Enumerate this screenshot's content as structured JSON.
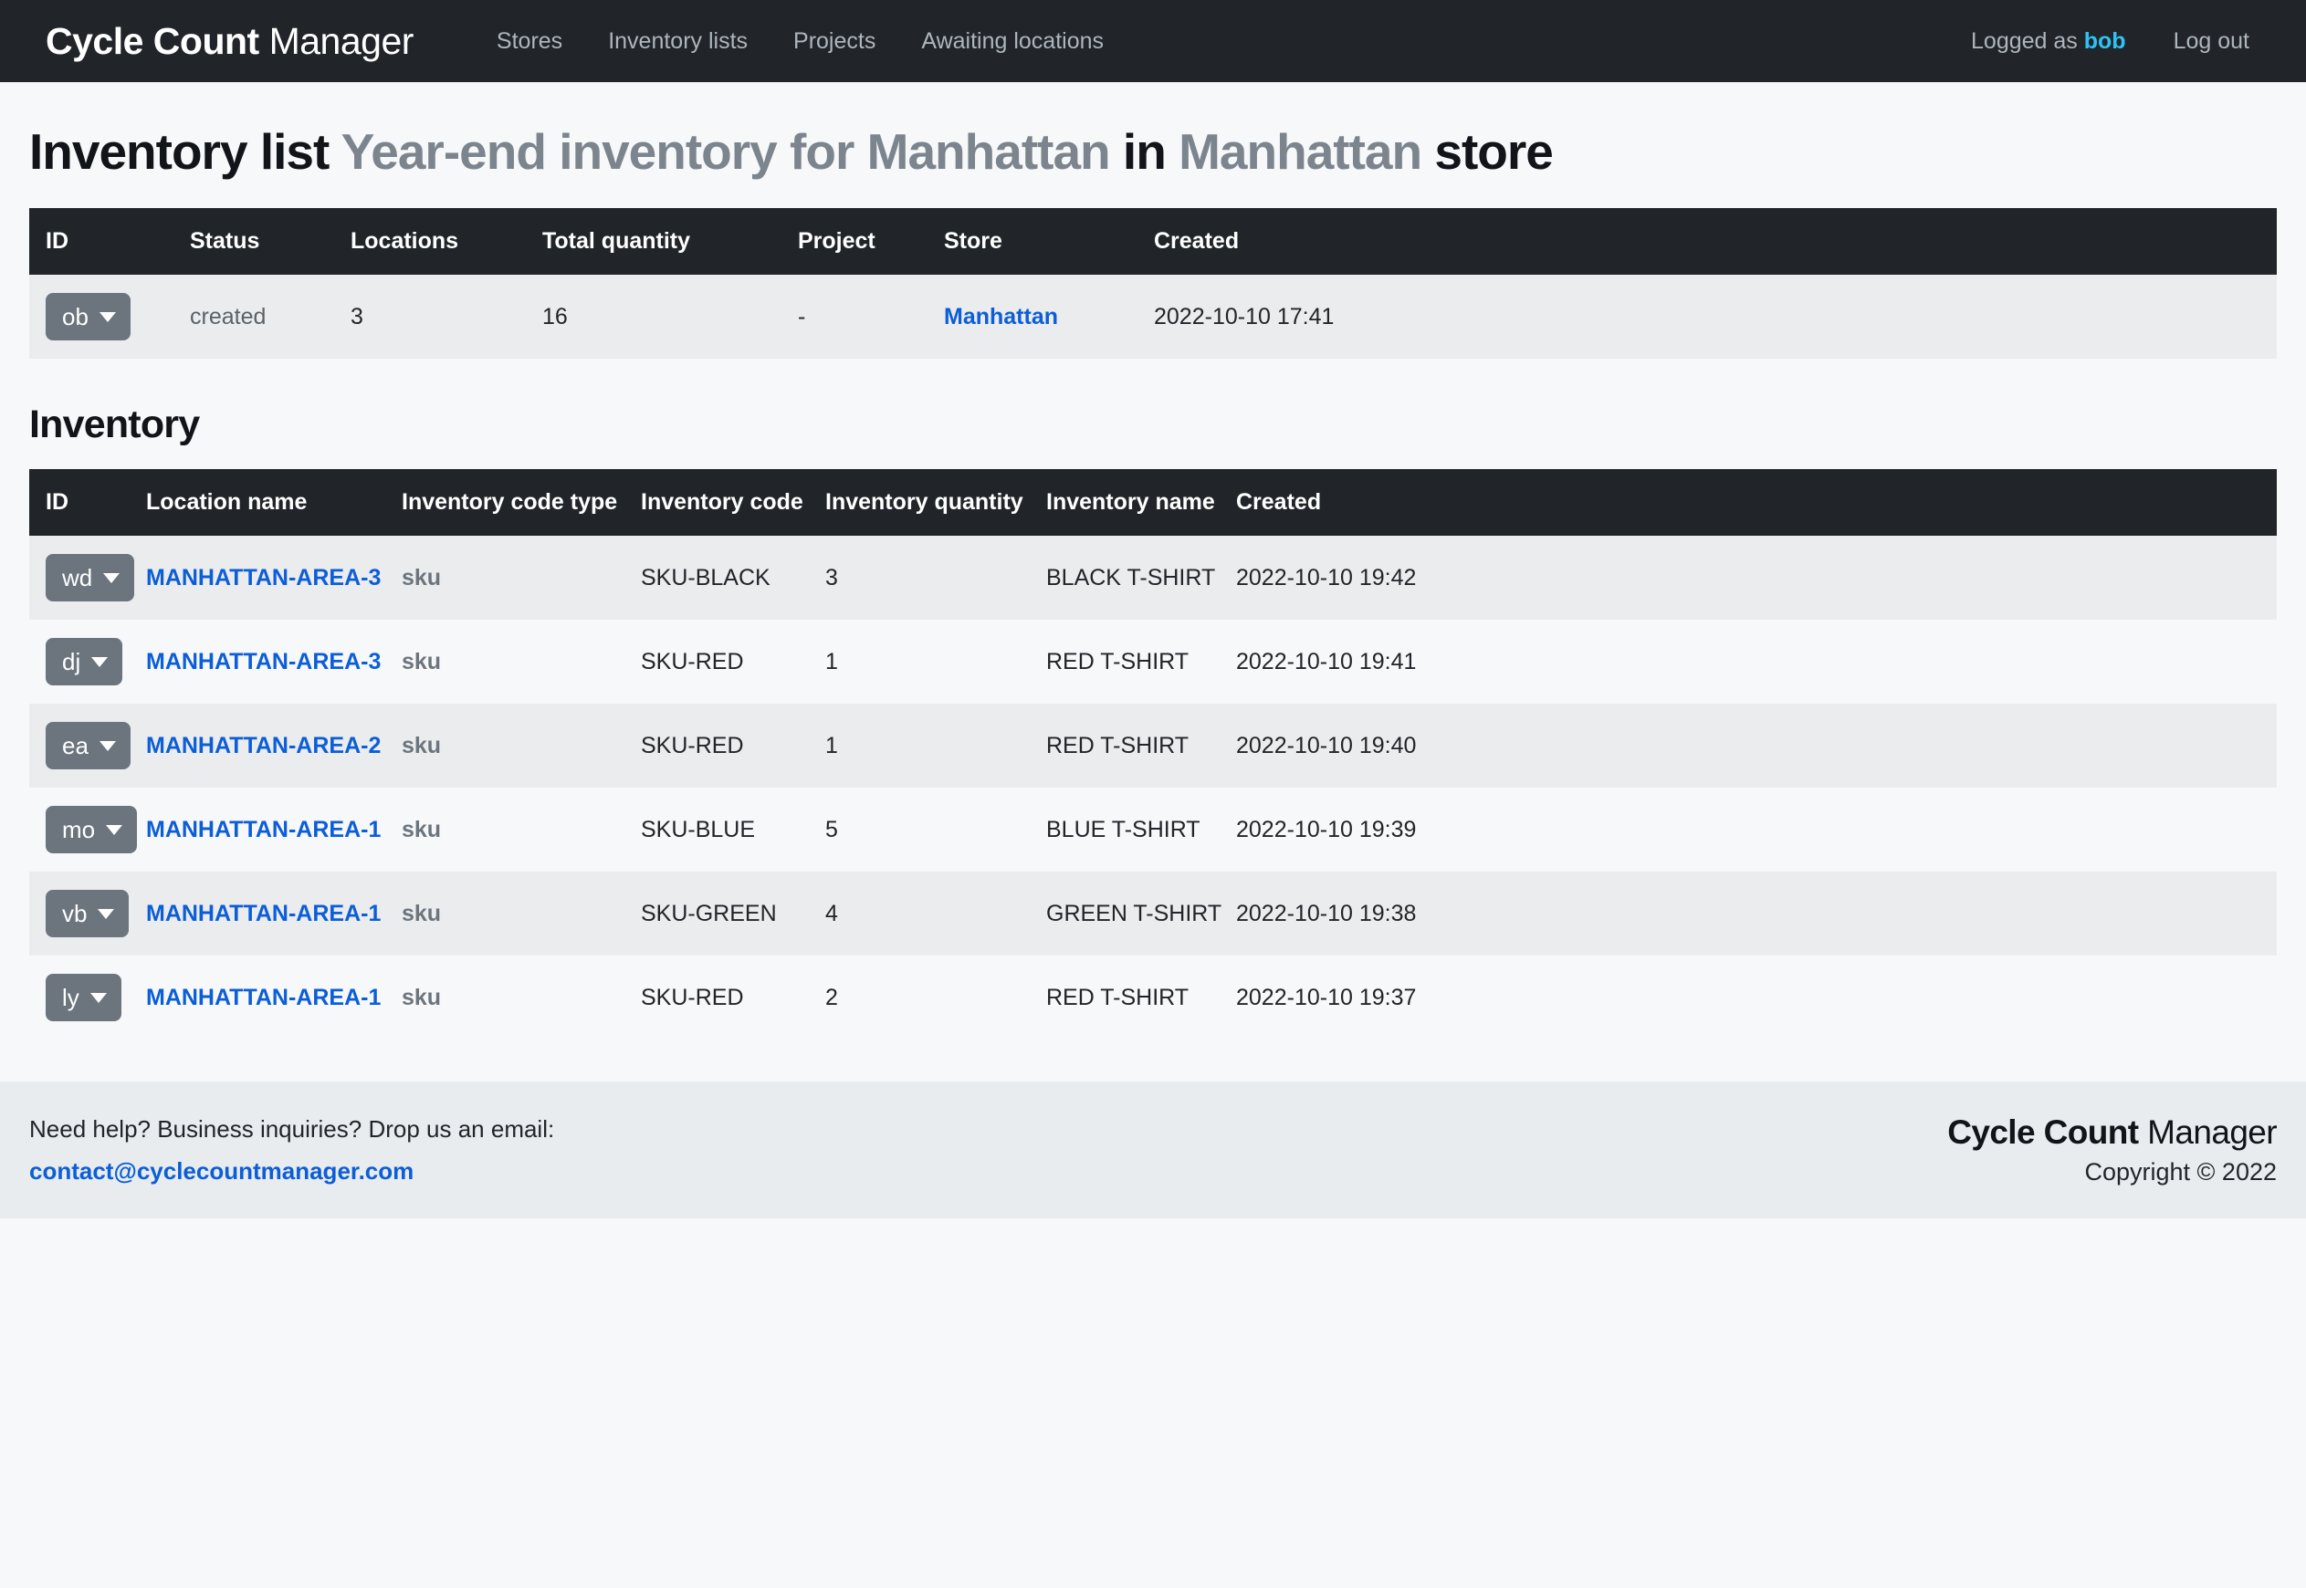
{
  "navbar": {
    "brand_strong": "Cycle Count",
    "brand_light": " Manager",
    "links": [
      {
        "label": "Stores"
      },
      {
        "label": "Inventory lists"
      },
      {
        "label": "Projects"
      },
      {
        "label": "Awaiting locations"
      }
    ],
    "logged_as_prefix": "Logged as ",
    "username": "bob",
    "logout_label": "Log out"
  },
  "page": {
    "title_prefix": "Inventory list ",
    "title_list_name": "Year-end inventory for Manhattan",
    "title_in": " in ",
    "title_store_name": "Manhattan",
    "title_suffix": " store",
    "section_inventory": "Inventory"
  },
  "list_table": {
    "headers": [
      "ID",
      "Status",
      "Locations",
      "Total quantity",
      "Project",
      "Store",
      "Created"
    ],
    "rows": [
      {
        "id": "ob",
        "status": "created",
        "locations": "3",
        "total_quantity": "16",
        "project": "-",
        "store": "Manhattan",
        "created": "2022-10-10 17:41"
      }
    ]
  },
  "inventory_table": {
    "headers": [
      "ID",
      "Location name",
      "Inventory code type",
      "Inventory code",
      "Inventory quantity",
      "Inventory name",
      "Created"
    ],
    "rows": [
      {
        "id": "wd",
        "location_name": "MANHATTAN-AREA-3",
        "inventory_code_type": "sku",
        "inventory_code": "SKU-BLACK",
        "inventory_quantity": "3",
        "inventory_name": "BLACK T-SHIRT",
        "created": "2022-10-10 19:42"
      },
      {
        "id": "dj",
        "location_name": "MANHATTAN-AREA-3",
        "inventory_code_type": "sku",
        "inventory_code": "SKU-RED",
        "inventory_quantity": "1",
        "inventory_name": "RED T-SHIRT",
        "created": "2022-10-10 19:41"
      },
      {
        "id": "ea",
        "location_name": "MANHATTAN-AREA-2",
        "inventory_code_type": "sku",
        "inventory_code": "SKU-RED",
        "inventory_quantity": "1",
        "inventory_name": "RED T-SHIRT",
        "created": "2022-10-10 19:40"
      },
      {
        "id": "mo",
        "location_name": "MANHATTAN-AREA-1",
        "inventory_code_type": "sku",
        "inventory_code": "SKU-BLUE",
        "inventory_quantity": "5",
        "inventory_name": "BLUE T-SHIRT",
        "created": "2022-10-10 19:39"
      },
      {
        "id": "vb",
        "location_name": "MANHATTAN-AREA-1",
        "inventory_code_type": "sku",
        "inventory_code": "SKU-GREEN",
        "inventory_quantity": "4",
        "inventory_name": "GREEN T-SHIRT",
        "created": "2022-10-10 19:38"
      },
      {
        "id": "ly",
        "location_name": "MANHATTAN-AREA-1",
        "inventory_code_type": "sku",
        "inventory_code": "SKU-RED",
        "inventory_quantity": "2",
        "inventory_name": "RED T-SHIRT",
        "created": "2022-10-10 19:37"
      }
    ]
  },
  "footer": {
    "help_text": "Need help? Business inquiries? Drop us an email:",
    "email": "contact@cyclecountmanager.com",
    "brand_strong": "Cycle Count",
    "brand_light": " Manager",
    "copyright": "Copyright © 2022"
  },
  "colors": {
    "navbar_bg": "#212529",
    "page_bg": "#f7f8fa",
    "link_blue": "#0b5ed7",
    "username_cyan": "#2ec2f5",
    "dropdown_gray": "#6c757d",
    "stripe_gray": "#ebecee",
    "footer_bg": "#e9ecef"
  }
}
